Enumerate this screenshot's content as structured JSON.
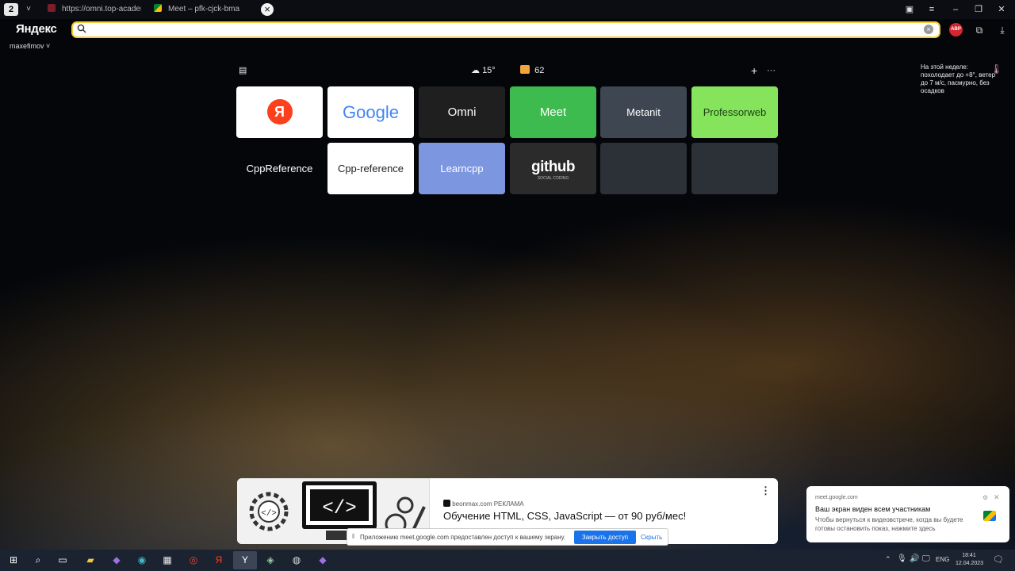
{
  "browser": {
    "tab_count": "2",
    "tabs": [
      {
        "title": "https://omni.top-academy.ru",
        "icon": "top-academy-icon"
      },
      {
        "title": "Meet – pfk-cjck-bma",
        "icon": "google-meet-icon"
      }
    ],
    "logo": "Яндекс",
    "user": "maxefimov ˅",
    "search": {
      "value": "",
      "placeholder": ""
    },
    "abp_badge": "ABP"
  },
  "newtab": {
    "weather_temp": "15°",
    "mail_count": "62",
    "tiles": [
      {
        "label": "Я",
        "bg": "#ffffff",
        "fg": "#ffffff"
      },
      {
        "label": "Google",
        "bg": "#ffffff",
        "fg": "#4285f4"
      },
      {
        "label": "Omni",
        "bg": "#1f1f1f",
        "fg": "#ffffff"
      },
      {
        "label": "Meet",
        "bg": "#3dbb4f",
        "fg": "#ffffff"
      },
      {
        "label": "Metanit",
        "bg": "#3e4652",
        "fg": "#ffffff"
      },
      {
        "label": "Professorweb",
        "bg": "#86e45c",
        "fg": "#1a3d12"
      },
      {
        "label": "CppReference",
        "bg": "transparent",
        "fg": "#ffffff"
      },
      {
        "label": "Cpp-reference",
        "bg": "#ffffff",
        "fg": "#222222"
      },
      {
        "label": "Learncpp",
        "bg": "#7c96e0",
        "fg": "#ffffff"
      },
      {
        "label": "github",
        "sub": "SOCIAL CODING",
        "bg": "#2b2b2b",
        "fg": "#ffffff"
      },
      {
        "label": "",
        "bg": "rgba(120,130,140,0.35)",
        "fg": "#ffffff"
      },
      {
        "label": "",
        "bg": "rgba(120,130,140,0.35)",
        "fg": "#ffffff"
      }
    ],
    "weather_note": "На этой неделе: похолодает до +8°, ветер до 7 м/с, пасмурно, без осадков"
  },
  "ad": {
    "source": "beonmax.com РЕКЛАМА",
    "title": "Обучение HTML, CSS, JavaScript — от 90 руб/мес!"
  },
  "share_bar": {
    "text": "Приложению meet.google.com предоставлен доступ к вашему экрану.",
    "stop_button": "Закрыть доступ",
    "hide_button": "Скрыть"
  },
  "notification": {
    "source": "meet.google.com",
    "title": "Ваш экран виден всем участникам",
    "body": "Чтобы вернуться к видеовстрече, когда вы будете готовы остановить показ, нажмите здесь"
  },
  "taskbar": {
    "lang": "ENG",
    "time": "18:41",
    "date": "12.04.2023"
  },
  "colors": {
    "search_border": "#f8cc33",
    "share_button": "#1a73e8",
    "yandex_red": "#fc3f1d"
  }
}
